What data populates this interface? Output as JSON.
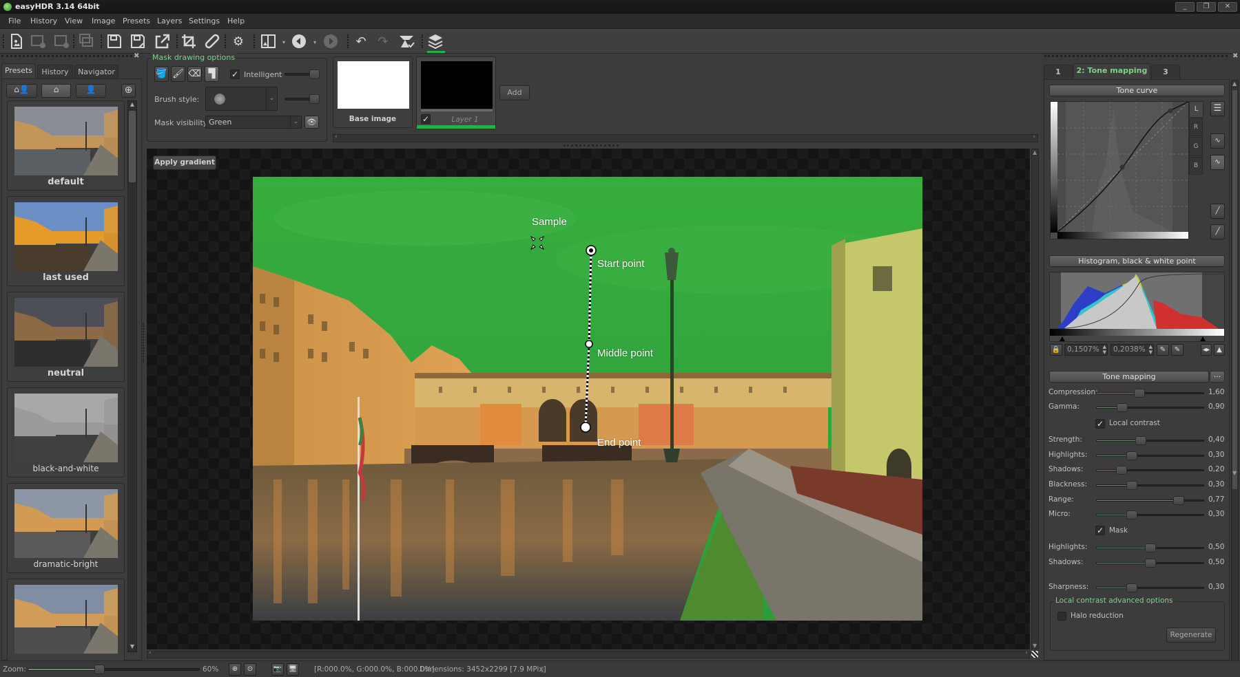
{
  "window": {
    "title": "easyHDR 3.14  64bit",
    "controls": {
      "minimize": "minimize-icon",
      "restore": "restore-icon",
      "close": "close-icon"
    }
  },
  "menu": [
    "File",
    "History",
    "View",
    "Image",
    "Presets",
    "Layers",
    "Settings",
    "Help"
  ],
  "toolbar": {
    "buttons": [
      {
        "name": "open-image",
        "icon": "open-file-icon",
        "enabled": true
      },
      {
        "name": "add-image",
        "icon": "add-image-icon",
        "enabled": false
      },
      {
        "name": "remove-image",
        "icon": "remove-image-icon",
        "enabled": false
      },
      {
        "name": "batch",
        "icon": "batch-icon",
        "enabled": false
      },
      {
        "name": "save",
        "icon": "save-icon",
        "enabled": true
      },
      {
        "name": "save-as",
        "icon": "save-as-icon",
        "enabled": true
      },
      {
        "name": "export",
        "icon": "export-icon",
        "enabled": true
      },
      {
        "name": "crop",
        "icon": "crop-icon",
        "enabled": true
      },
      {
        "name": "heal",
        "icon": "bandage-icon",
        "enabled": true
      },
      {
        "name": "settings",
        "icon": "gear-icon",
        "enabled": true
      },
      {
        "name": "compare-view",
        "icon": "split-view-icon",
        "enabled": true
      },
      {
        "name": "back",
        "icon": "arrow-left-circle-icon",
        "enabled": true
      },
      {
        "name": "forward",
        "icon": "arrow-right-circle-icon",
        "enabled": false
      },
      {
        "name": "undo",
        "icon": "undo-icon",
        "enabled": true
      },
      {
        "name": "redo",
        "icon": "redo-icon",
        "enabled": false
      },
      {
        "name": "tone-mapping-apply",
        "icon": "tone-mapping-icon",
        "enabled": true
      },
      {
        "name": "layers",
        "icon": "layers-icon",
        "enabled": true,
        "active": true
      }
    ]
  },
  "left_panel": {
    "tabs": [
      "Presets",
      "History",
      "Navigator"
    ],
    "active_tab": "Presets",
    "filter_buttons": [
      "all-presets-icon",
      "built-in-presets-icon",
      "user-presets-icon"
    ],
    "add_button_icon": "plus-circle-icon",
    "presets": [
      {
        "label": "default",
        "bold": true
      },
      {
        "label": "last used",
        "bold": true
      },
      {
        "label": "neutral",
        "bold": true
      },
      {
        "label": "black-and-white",
        "bold": false
      },
      {
        "label": "dramatic-bright",
        "bold": false
      },
      {
        "label": "",
        "bold": false
      }
    ]
  },
  "mask_options": {
    "title": "Mask drawing options",
    "tools": [
      "fill-bucket-icon",
      "brush-icon",
      "eraser-icon",
      "gradient-roller-icon"
    ],
    "intelligent_label": "Intelligent",
    "intelligent_checked": true,
    "intelligent_strength": 0.9,
    "brush_style_label": "Brush style:",
    "brush_size": 0.9,
    "mask_visibility_label": "Mask visibility:",
    "mask_visibility_value": "Green",
    "visibility_icon": "eye-icon"
  },
  "layers": {
    "items": [
      {
        "label": "Base image",
        "checked": null
      },
      {
        "label": "Layer 1",
        "checked": true,
        "selected": true
      }
    ],
    "add_label": "Add"
  },
  "canvas": {
    "apply_gradient_label": "Apply gradient",
    "overlay": {
      "sample_label": "Sample",
      "start_label": "Start point",
      "middle_label": "Middle point",
      "end_label": "End point"
    }
  },
  "right_panel": {
    "tabs": [
      "1",
      "2: Tone mapping",
      "3"
    ],
    "active_tab": "2: Tone mapping",
    "tone_curve": {
      "title": "Tone curve",
      "channels": [
        "L",
        "R",
        "G",
        "B"
      ],
      "active_channel": "L"
    },
    "histogram": {
      "title": "Histogram, black & white point",
      "black_point": "0,1507%",
      "white_point": "0,2038%"
    },
    "tone_mapping": {
      "title": "Tone mapping",
      "more_label": "···",
      "sliders_top": [
        {
          "label": "Compression:",
          "value": "1,60",
          "pos": 0.4
        },
        {
          "label": "Gamma:",
          "value": "0,90",
          "pos": 0.24
        }
      ],
      "local_contrast_label": "Local contrast",
      "local_contrast_checked": true,
      "sliders_lc": [
        {
          "label": "Strength:",
          "value": "0,40",
          "pos": 0.41
        },
        {
          "label": "Highlights:",
          "value": "0,30",
          "pos": 0.33
        },
        {
          "label": "Shadows:",
          "value": "0,20",
          "pos": 0.23
        },
        {
          "label": "Blackness:",
          "value": "0,30",
          "pos": 0.33
        },
        {
          "label": "Range:",
          "value": "0,77",
          "pos": 0.77
        },
        {
          "label": "Micro:",
          "value": "0,30",
          "pos": 0.33
        }
      ],
      "mask_label": "Mask",
      "mask_checked": true,
      "sliders_mask": [
        {
          "label": "Highlights:",
          "value": "0,50",
          "pos": 0.5
        },
        {
          "label": "Shadows:",
          "value": "0,50",
          "pos": 0.5
        }
      ],
      "sharpness": {
        "label": "Sharpness:",
        "value": "0,30",
        "pos": 0.33
      },
      "advanced_title": "Local contrast advanced options",
      "halo_label": "Halo reduction",
      "halo_checked": false,
      "regenerate_label": "Regenerate"
    }
  },
  "status": {
    "zoom_label": "Zoom:",
    "zoom_value": "60%",
    "zoom_pos": 0.42,
    "pixel_info": "[R:000.0%, G:000.0%, B:000.0%]",
    "dimensions": "Dimensions:  3452x2299 [7.9 MPix]"
  },
  "colors": {
    "accent_green": "#7fd18a",
    "layer_active": "#1fb34a",
    "mask_overlay": "#2fae3a"
  }
}
